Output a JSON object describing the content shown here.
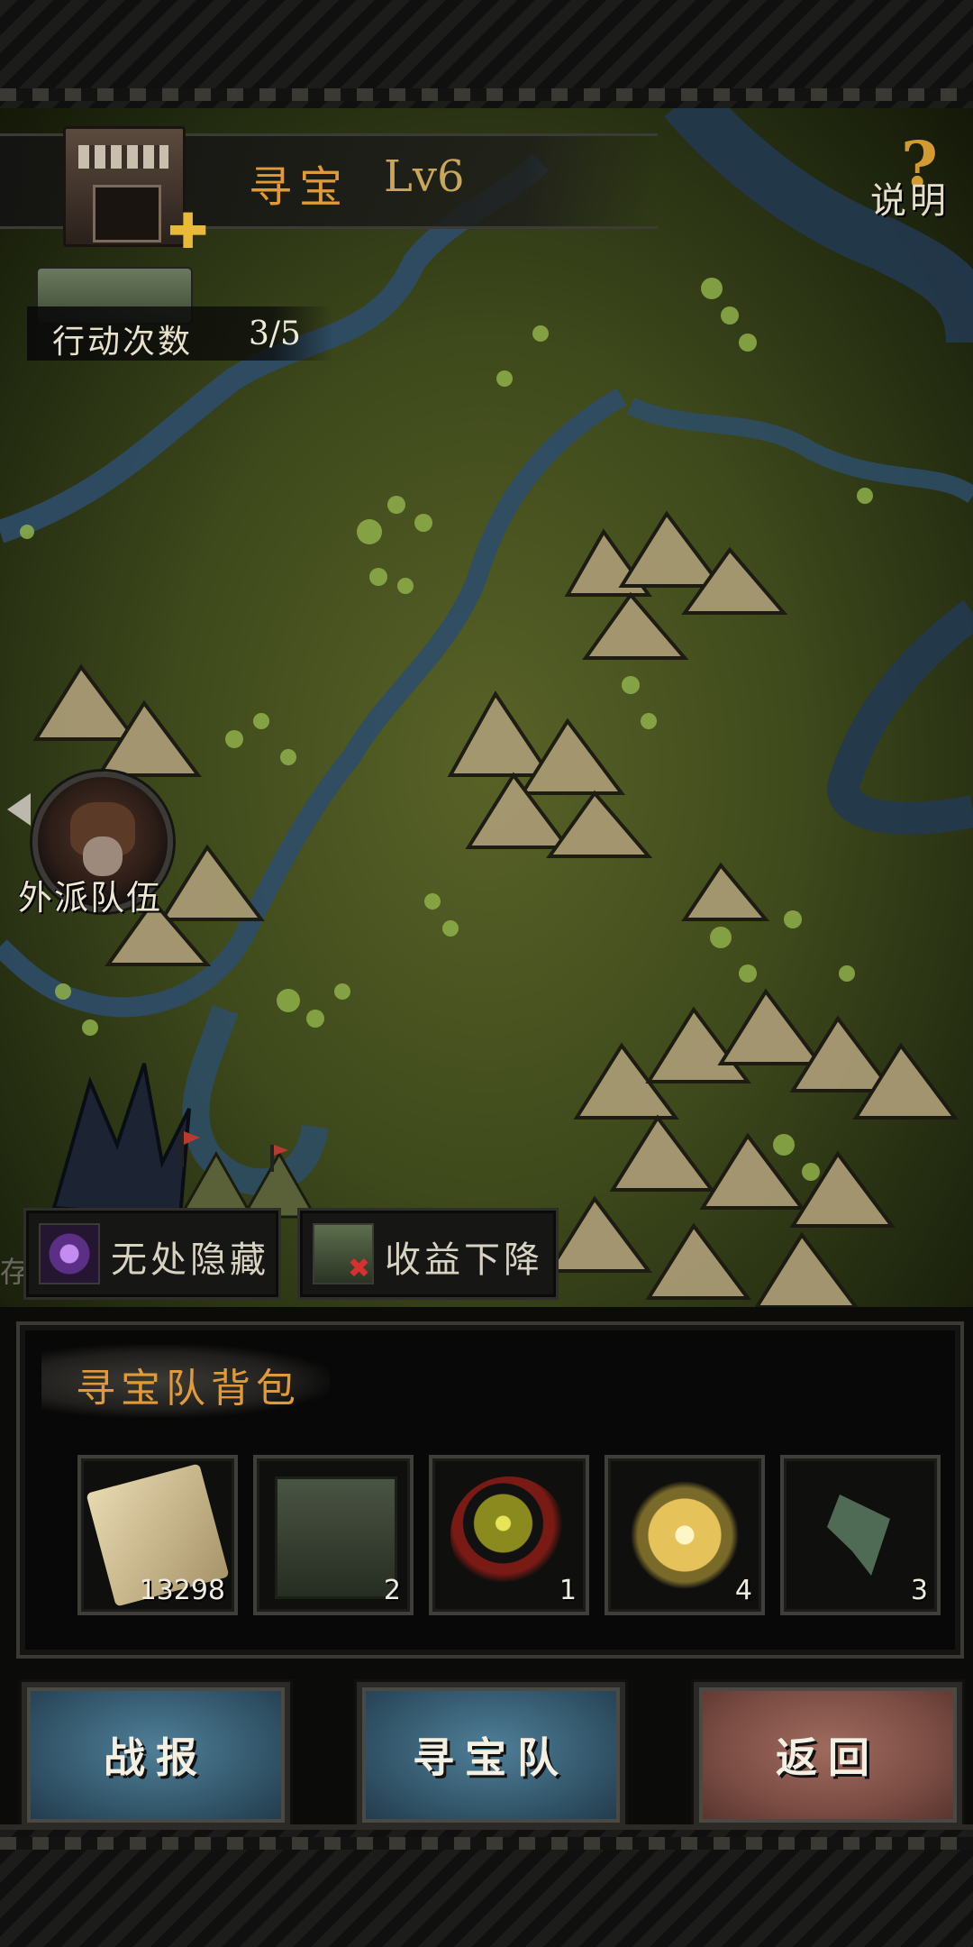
{
  "header": {
    "title_name": "寻宝",
    "title_level": "Lv6",
    "help_label": "说明",
    "help_mark": "?"
  },
  "actions": {
    "label": "行动次数",
    "value": "3/5"
  },
  "map": {
    "squad_label": "外派队伍",
    "edge_text": "存"
  },
  "effects": [
    {
      "label": "无处隐藏",
      "icon": "eye-icon"
    },
    {
      "label": "收益下降",
      "icon": "money-down-icon"
    }
  ],
  "backpack": {
    "title": "寻宝队背包",
    "items": [
      {
        "icon": "scroll-icon",
        "count": "13298"
      },
      {
        "icon": "crate-icon",
        "count": "2"
      },
      {
        "icon": "orb-icon",
        "count": "1"
      },
      {
        "icon": "crystal-icon",
        "count": "4"
      },
      {
        "icon": "shard-icon",
        "count": "3"
      }
    ]
  },
  "buttons": {
    "report": "战报",
    "team": "寻宝队",
    "back": "返回"
  },
  "colors": {
    "accent_orange": "#e09a3a",
    "button_blue": "#33566a",
    "button_red": "#7a4c43"
  }
}
